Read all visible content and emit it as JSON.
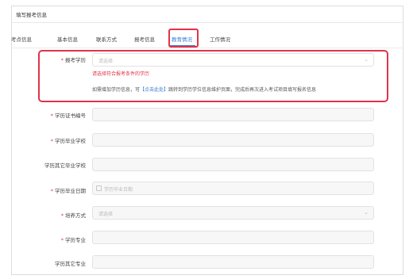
{
  "page": {
    "title": "填写报考信息"
  },
  "tabs": [
    {
      "label": "考点信息"
    },
    {
      "label": "基本信息"
    },
    {
      "label": "联系方式"
    },
    {
      "label": "报考信息"
    },
    {
      "label": "教育情况"
    },
    {
      "label": "工作情况"
    }
  ],
  "active_tab": "教育情况",
  "form": {
    "required_mark": "*",
    "edu_level": {
      "label": "报考学历",
      "placeholder": "请选择"
    },
    "edu_error": "请选择符合报考条件的学历",
    "hint": {
      "prefix": "如需增加学历信息，可",
      "link": "【点击此处】",
      "suffix": "跳转到学历学位信息维护页面，完成后再次进入考试项目填写报名信息"
    },
    "cert_no": {
      "label": "学历证书编号"
    },
    "grad_school": {
      "label": "学历毕业学校"
    },
    "other_school": {
      "label": "学历其它毕业学校"
    },
    "grad_date": {
      "label": "学历毕业日期",
      "placeholder": "学历毕业日期"
    },
    "training_mode": {
      "label": "培养方式",
      "placeholder": "请选择"
    },
    "major": {
      "label": "学历专业"
    },
    "other_major": {
      "label": "学历其它专业"
    }
  }
}
